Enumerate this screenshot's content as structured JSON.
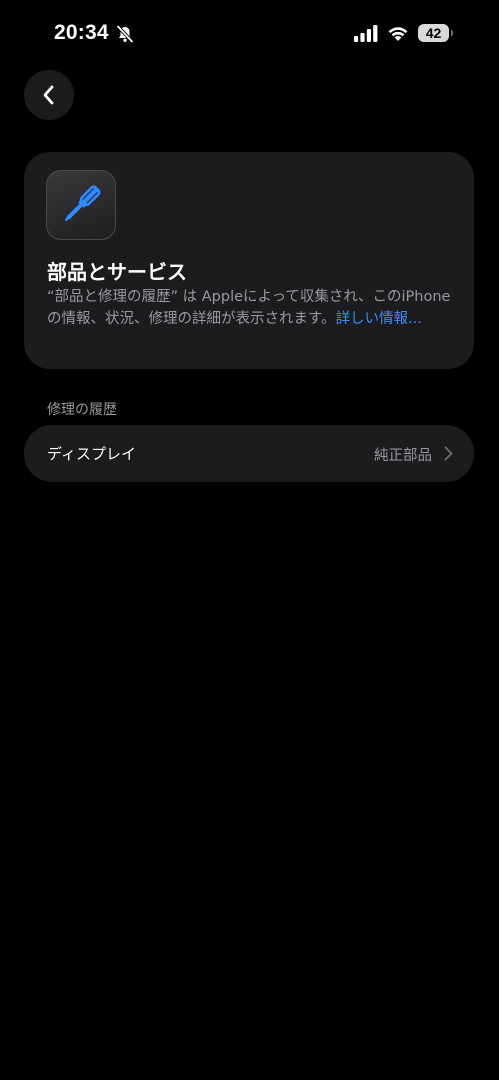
{
  "status_bar": {
    "time": "20:34",
    "battery": "42"
  },
  "card": {
    "title": "部品とサービス",
    "description": "“部品と修理の履歴” は Appleによって収集され、このiPhoneの情報、状況、修理の詳細が表示されます。",
    "link": "詳しい情報..."
  },
  "repair_history": {
    "section_title": "修理の履歴",
    "items": [
      {
        "label": "ディスプレイ",
        "value": "純正部品"
      }
    ]
  },
  "colors": {
    "background": "#000000",
    "card": "#1c1c1e",
    "secondary_text": "#98989f",
    "link": "#3a8dff",
    "icon_accent": "#2f8cff"
  }
}
